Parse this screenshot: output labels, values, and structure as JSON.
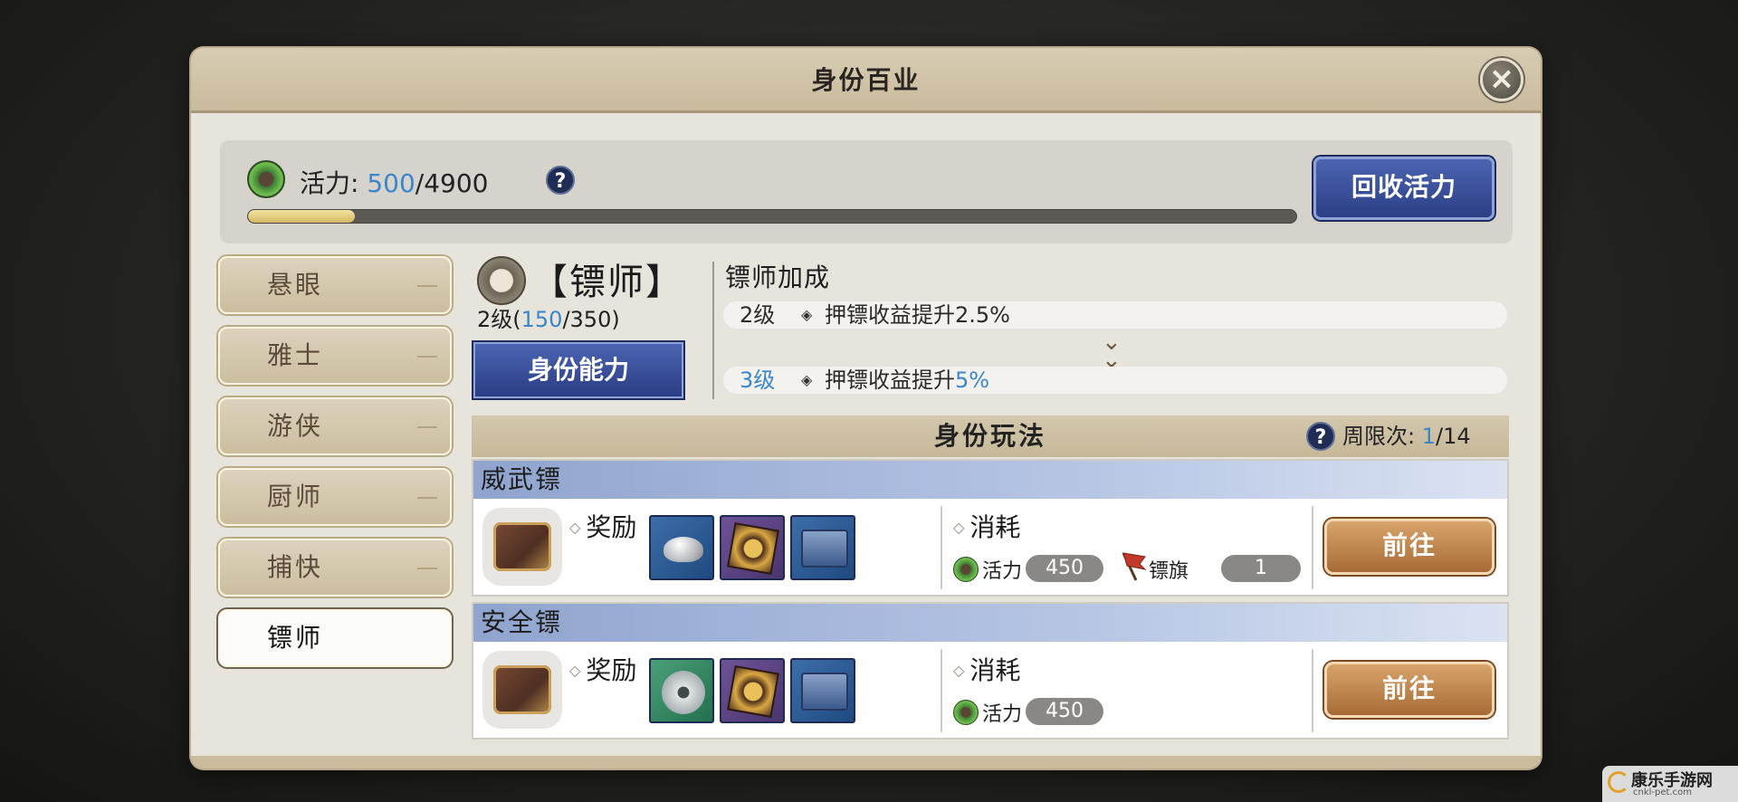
{
  "window": {
    "title": "身份百业"
  },
  "vitality": {
    "label": "活力:",
    "current": "500",
    "separator": "/",
    "max": "4900",
    "help": "?",
    "progress_fraction": 0.102,
    "reclaim_button": "回收活力"
  },
  "tabs": [
    {
      "label": "悬眼",
      "active": false
    },
    {
      "label": "雅士",
      "active": false
    },
    {
      "label": "游侠",
      "active": false
    },
    {
      "label": "厨师",
      "active": false
    },
    {
      "label": "捕快",
      "active": false
    },
    {
      "label": "镖师",
      "active": true
    }
  ],
  "identity": {
    "name": "【镖师】",
    "level_prefix": "2级(",
    "exp_current": "150",
    "exp_rest": "/350)",
    "ability_button": "身份能力"
  },
  "bonus": {
    "title": "镖师加成",
    "current": {
      "level": "2级",
      "text": "押镖收益提升2.5%"
    },
    "next": {
      "level": "3级",
      "text": "押镖收益提升",
      "value": "5%"
    }
  },
  "gameplay": {
    "title": "身份玩法",
    "help": "?",
    "limit_label": "周限次:",
    "limit_current": "1",
    "limit_rest": "/14"
  },
  "escorts": [
    {
      "name": "威武镖",
      "reward_label": "奖励",
      "rewards": [
        "silver-ingot-icon",
        "board-icon",
        "chest-icon"
      ],
      "cost_label": "消耗",
      "costs": [
        {
          "name": "活力",
          "amount": "450",
          "icon": "vitality-icon"
        },
        {
          "name": "镖旗",
          "amount": "1",
          "icon": "flag-icon"
        }
      ],
      "go_button": "前往"
    },
    {
      "name": "安全镖",
      "reward_label": "奖励",
      "rewards": [
        "coin-icon",
        "board-icon",
        "chest-icon"
      ],
      "cost_label": "消耗",
      "costs": [
        {
          "name": "活力",
          "amount": "450",
          "icon": "vitality-icon"
        }
      ],
      "go_button": "前往"
    }
  ],
  "watermark": {
    "title": "康乐手游网",
    "subtitle": "cnkl-pet.com"
  },
  "colors": {
    "accent_blue": "#3a86c9",
    "button_blue": "#2b3f85",
    "button_orange": "#a86b37"
  }
}
